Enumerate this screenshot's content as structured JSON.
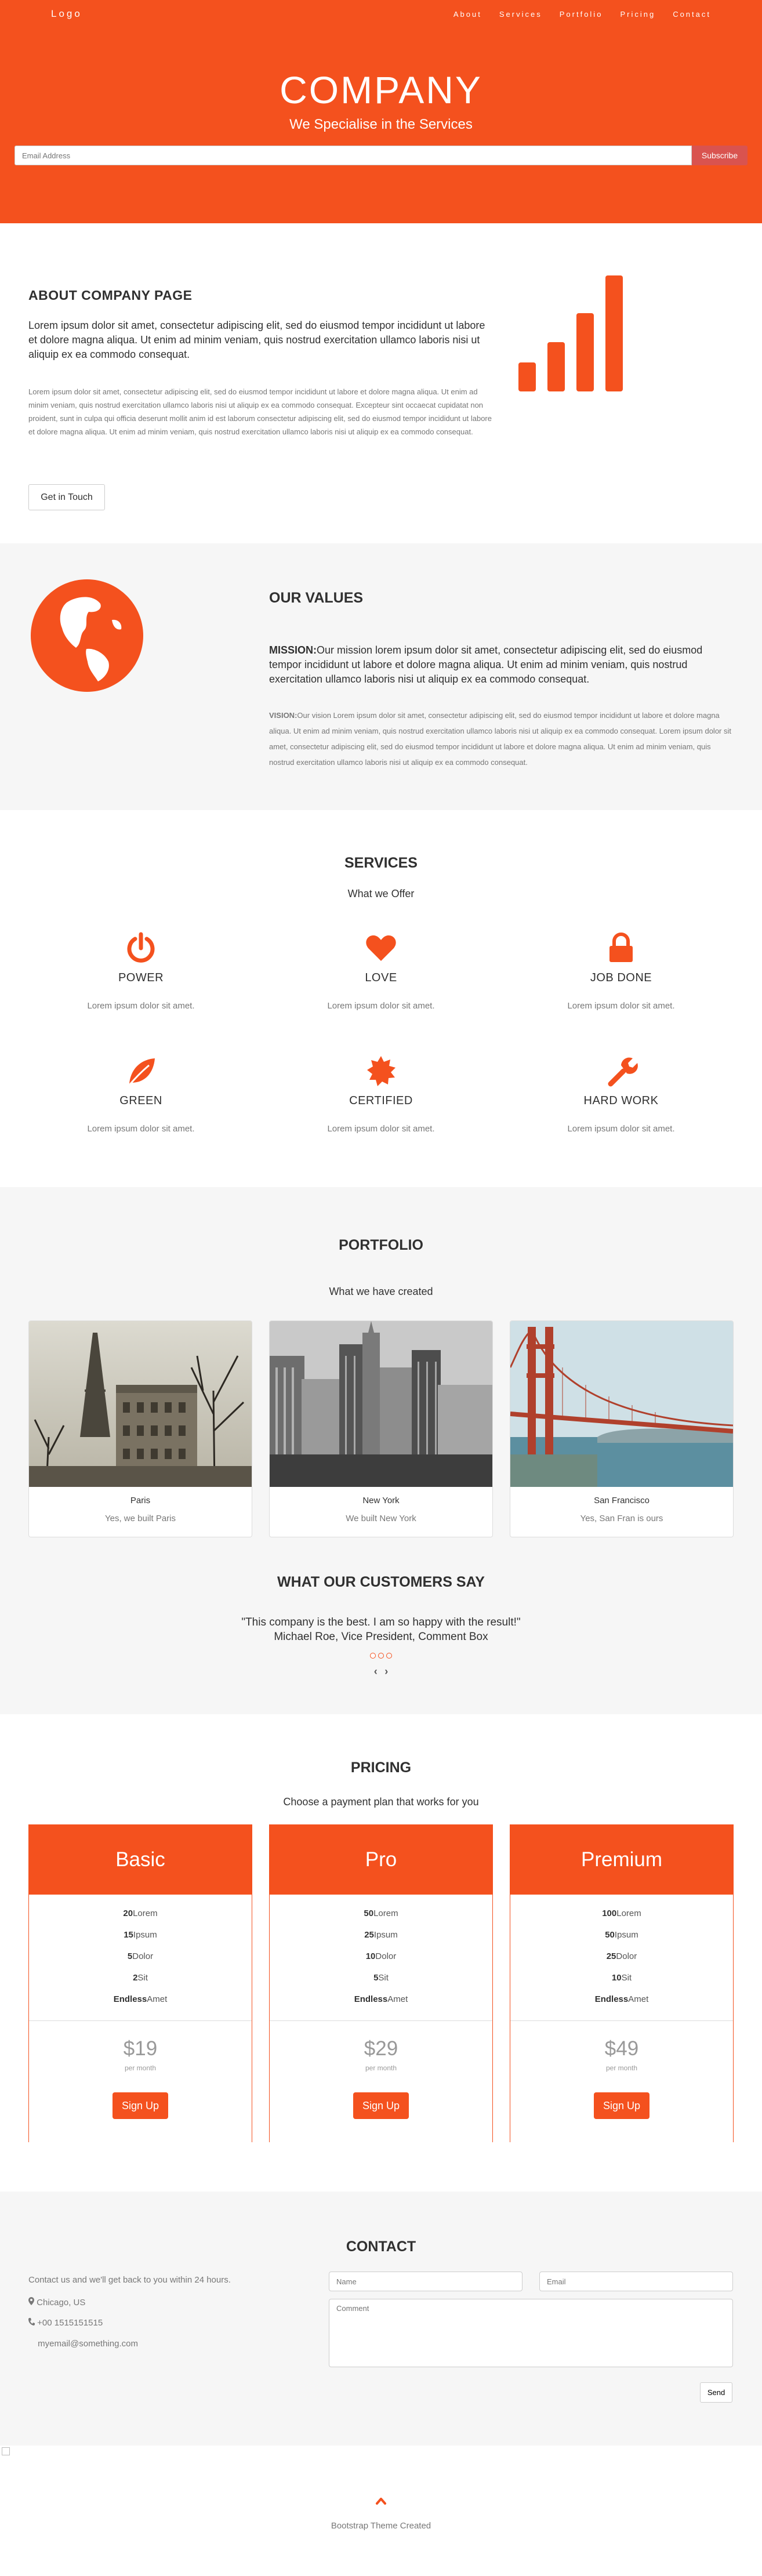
{
  "nav": {
    "logo": "Logo",
    "links": [
      "About",
      "Services",
      "Portfolio",
      "Pricing",
      "Contact"
    ]
  },
  "hero": {
    "title": "COMPANY",
    "subtitle": "We Specialise in the Services",
    "email_placeholder": "Email Address",
    "subscribe_label": "Subscribe"
  },
  "about": {
    "title": "ABOUT COMPANY PAGE",
    "lead": "Lorem ipsum dolor sit amet, consectetur adipiscing elit, sed do eiusmod tempor incididunt ut labore et dolore magna aliqua. Ut enim ad minim veniam, quis nostrud exercitation ullamco laboris nisi ut aliquip ex ea commodo consequat.",
    "body": "Lorem ipsum dolor sit amet, consectetur adipiscing elit, sed do eiusmod tempor incididunt ut labore et dolore magna aliqua. Ut enim ad minim veniam, quis nostrud exercitation ullamco laboris nisi ut aliquip ex ea commodo consequat. Excepteur sint occaecat cupidatat non proident, sunt in culpa qui officia deserunt mollit anim id est laborum consectetur adipiscing elit, sed do eiusmod tempor incididunt ut labore et dolore magna aliqua. Ut enim ad minim veniam, quis nostrud exercitation ullamco laboris nisi ut aliquip ex ea commodo consequat.",
    "button": "Get in Touch",
    "icon": "signal-icon"
  },
  "values": {
    "title": "OUR VALUES",
    "mission_label": "MISSION:",
    "mission": "Our mission lorem ipsum dolor sit amet, consectetur adipiscing elit, sed do eiusmod tempor incididunt ut labore et dolore magna aliqua. Ut enim ad minim veniam, quis nostrud exercitation ullamco laboris nisi ut aliquip ex ea commodo consequat.",
    "vision_label": "VISION:",
    "vision": "Our vision Lorem ipsum dolor sit amet, consectetur adipiscing elit, sed do eiusmod tempor incididunt ut labore et dolore magna aliqua. Ut enim ad minim veniam, quis nostrud exercitation ullamco laboris nisi ut aliquip ex ea commodo consequat. Lorem ipsum dolor sit amet, consectetur adipiscing elit, sed do eiusmod tempor incididunt ut labore et dolore magna aliqua. Ut enim ad minim veniam, quis nostrud exercitation ullamco laboris nisi ut aliquip ex ea commodo consequat.",
    "icon": "globe-icon"
  },
  "services": {
    "title": "SERVICES",
    "subtitle": "What we Offer",
    "items": [
      {
        "icon": "power-icon",
        "title": "POWER",
        "desc": "Lorem ipsum dolor sit amet."
      },
      {
        "icon": "heart-icon",
        "title": "LOVE",
        "desc": "Lorem ipsum dolor sit amet."
      },
      {
        "icon": "lock-icon",
        "title": "JOB DONE",
        "desc": "Lorem ipsum dolor sit amet."
      },
      {
        "icon": "leaf-icon",
        "title": "GREEN",
        "desc": "Lorem ipsum dolor sit amet."
      },
      {
        "icon": "certificate-icon",
        "title": "CERTIFIED",
        "desc": "Lorem ipsum dolor sit amet."
      },
      {
        "icon": "wrench-icon",
        "title": "HARD WORK",
        "desc": "Lorem ipsum dolor sit amet."
      }
    ]
  },
  "portfolio": {
    "title": "PORTFOLIO",
    "subtitle": "What we have created",
    "items": [
      {
        "caption": "Paris",
        "desc": "Yes, we built Paris"
      },
      {
        "caption": "New York",
        "desc": "We built New York"
      },
      {
        "caption": "San Francisco",
        "desc": "Yes, San Fran is ours"
      }
    ]
  },
  "testimonials": {
    "title": "WHAT OUR CUSTOMERS SAY",
    "quote": "\"This company is the best. I am so happy with the result!\"",
    "author": "Michael Roe, Vice President, Comment Box",
    "prev": "‹",
    "next": "›"
  },
  "pricing": {
    "title": "PRICING",
    "subtitle": "Choose a payment plan that works for you",
    "per_label": "per month",
    "signup_label": "Sign Up",
    "plans": [
      {
        "name": "Basic",
        "price": "$19",
        "f1n": "20",
        "f2n": "15",
        "f3n": "5",
        "f4n": "2",
        "f5n": "Endless"
      },
      {
        "name": "Pro",
        "price": "$29",
        "f1n": "50",
        "f2n": "25",
        "f3n": "10",
        "f4n": "5",
        "f5n": "Endless"
      },
      {
        "name": "Premium",
        "price": "$49",
        "f1n": "100",
        "f2n": "50",
        "f3n": "25",
        "f4n": "10",
        "f5n": "Endless"
      }
    ],
    "feature_words": [
      "Lorem",
      "Ipsum",
      "Dolor",
      "Sit",
      "Amet"
    ]
  },
  "contact": {
    "title": "CONTACT",
    "intro": "Contact us and we'll get back to you within 24 hours.",
    "location": "Chicago, US",
    "phone": "+00 1515151515",
    "email": "myemail@something.com",
    "name_placeholder": "Name",
    "email_placeholder": "Email",
    "comment_placeholder": "Comment",
    "send_label": "Send"
  },
  "footer": {
    "credit": "Bootstrap Theme Created",
    "up_icon": "chevron-up-icon"
  },
  "colors": {
    "accent": "#f4511e",
    "subscribe": "#d9534f",
    "light_bg": "#f6f6f6"
  }
}
